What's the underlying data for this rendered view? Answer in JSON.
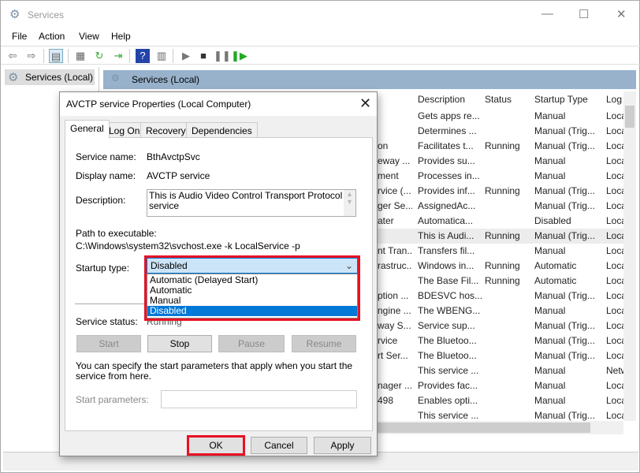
{
  "window": {
    "title": "Services",
    "minimize": "—",
    "maximize": "☐",
    "close": "✕"
  },
  "menu": [
    "File",
    "Action",
    "View",
    "Help"
  ],
  "toolbar": {
    "icons": [
      "back-icon",
      "forward-icon",
      "show-hide-console-tree-icon",
      "properties-icon",
      "refresh-icon",
      "export-list-icon",
      "help-icon",
      "action-pane-icon",
      "start-service-icon",
      "stop-service-icon",
      "pause-service-icon",
      "restart-service-icon"
    ]
  },
  "tree": {
    "item": "Services (Local)"
  },
  "main": {
    "header": "Services (Local)"
  },
  "list": {
    "columns": [
      "Description",
      "Status",
      "Startup Type",
      "Log"
    ],
    "rows": [
      [
        "",
        "Gets apps re...",
        "",
        "Manual",
        "Loca"
      ],
      [
        "",
        "Determines ...",
        "",
        "Manual (Trig...",
        "Loca"
      ],
      [
        "on",
        "Facilitates t...",
        "Running",
        "Manual (Trig...",
        "Loca"
      ],
      [
        "eway ...",
        "Provides su...",
        "",
        "Manual",
        "Loca"
      ],
      [
        "ment",
        "Processes in...",
        "",
        "Manual",
        "Loca"
      ],
      [
        "rvice (...",
        "Provides inf...",
        "Running",
        "Manual (Trig...",
        "Loca"
      ],
      [
        "ger Se...",
        "AssignedAc...",
        "",
        "Manual (Trig...",
        "Loca"
      ],
      [
        "ater",
        "Automatica...",
        "",
        "Disabled",
        "Loca"
      ],
      [
        "",
        "This is Audi...",
        "Running",
        "Manual (Trig...",
        "Loca"
      ],
      [
        "nt Tran...",
        "Transfers fil...",
        "",
        "Manual",
        "Loca"
      ],
      [
        "rastruc...",
        "Windows in...",
        "Running",
        "Automatic",
        "Loca"
      ],
      [
        "",
        "The Base Fil...",
        "Running",
        "Automatic",
        "Loca"
      ],
      [
        "ption ...",
        "BDESVC hos...",
        "",
        "Manual (Trig...",
        "Loca"
      ],
      [
        "ngine ...",
        "The WBENG...",
        "",
        "Manual",
        "Loca"
      ],
      [
        "way S...",
        "Service sup...",
        "",
        "Manual (Trig...",
        "Loca"
      ],
      [
        "rvice",
        "The Bluetoo...",
        "",
        "Manual (Trig...",
        "Loca"
      ],
      [
        "rt Ser...",
        "The Bluetoo...",
        "",
        "Manual (Trig...",
        "Loca"
      ],
      [
        "",
        "This service ...",
        "",
        "Manual",
        "Netw"
      ],
      [
        "nager ...",
        "Provides fac...",
        "",
        "Manual",
        "Loca"
      ],
      [
        "498",
        "Enables opti...",
        "",
        "Manual",
        "Loca"
      ],
      [
        "",
        "This service ...",
        "",
        "Manual (Trig...",
        "Loca"
      ]
    ],
    "selected_row": 8
  },
  "dialog": {
    "title": "AVCTP service Properties (Local Computer)",
    "tabs": [
      "General",
      "Log On",
      "Recovery",
      "Dependencies"
    ],
    "active_tab": "General",
    "service_name_label": "Service name:",
    "service_name": "BthAvctpSvc",
    "display_name_label": "Display name:",
    "display_name": "AVCTP service",
    "description_label": "Description:",
    "description": "This is Audio Video Control Transport Protocol service",
    "path_label": "Path to executable:",
    "path": "C:\\Windows\\system32\\svchost.exe -k LocalService -p",
    "startup_type_label": "Startup type:",
    "startup_type": "Disabled",
    "startup_options": [
      "Automatic (Delayed Start)",
      "Automatic",
      "Manual",
      "Disabled"
    ],
    "service_status_label": "Service status:",
    "service_status": "Running",
    "buttons": {
      "start": "Start",
      "stop": "Stop",
      "pause": "Pause",
      "resume": "Resume"
    },
    "hint": "You can specify the start parameters that apply when you start the service from here.",
    "start_params_label": "Start parameters:",
    "start_params_value": "",
    "ok": "OK",
    "cancel": "Cancel",
    "apply": "Apply"
  },
  "colors": {
    "highlight": "#e81123",
    "selection": "#0078d7",
    "combo": "#cce4f7"
  }
}
